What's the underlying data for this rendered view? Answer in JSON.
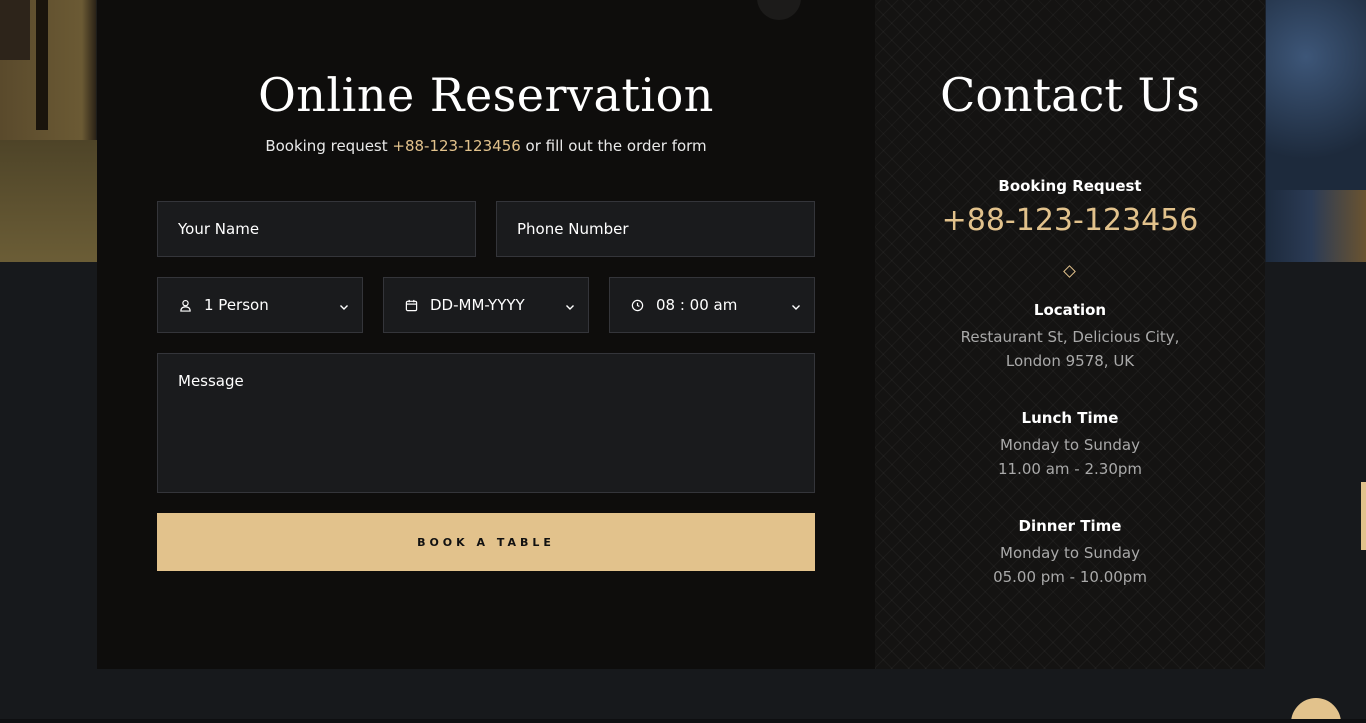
{
  "form": {
    "title": "Online Reservation",
    "subtitle_prefix": "Booking request ",
    "subtitle_phone": "+88-123-123456",
    "subtitle_suffix": " or fill out the order form",
    "name_placeholder": "Your Name",
    "phone_placeholder": "Phone Number",
    "persons_value": "1 Person",
    "date_value": "DD-MM-YYYY",
    "time_value": "08 : 00 am",
    "message_placeholder": "Message",
    "submit_label": "BOOK A TABLE"
  },
  "contact": {
    "title": "Contact Us",
    "booking_heading": "Booking Request",
    "booking_phone": "+88-123-123456",
    "location_heading": "Location",
    "location_line1": "Restaurant St, Delicious City,",
    "location_line2": "London 9578, UK",
    "lunch_heading": "Lunch Time",
    "lunch_days": "Monday to Sunday",
    "lunch_hours": "11.00 am - 2.30pm",
    "dinner_heading": "Dinner Time",
    "dinner_days": "Monday to Sunday",
    "dinner_hours": "05.00 pm - 10.00pm"
  },
  "theme": {
    "accent": "#e2c28c",
    "panel_bg": "#0e0d0c",
    "field_bg": "#1a1b1d"
  }
}
